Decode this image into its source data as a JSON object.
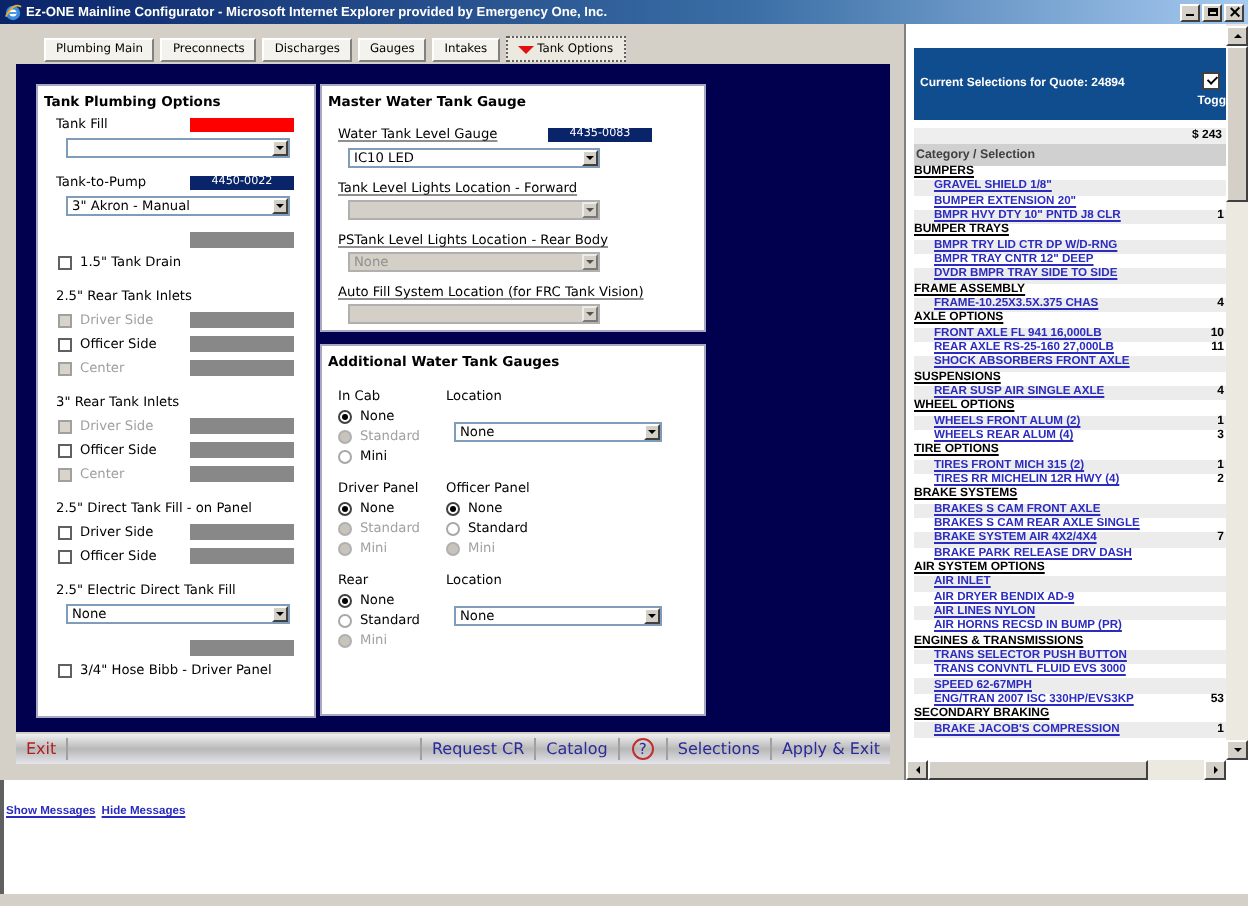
{
  "window": {
    "title": "Ez-ONE Mainline Configurator - Microsoft Internet Explorer provided by Emergency One, Inc."
  },
  "tabs": [
    {
      "label": "Plumbing Main",
      "selected": false
    },
    {
      "label": "Preconnects",
      "selected": false
    },
    {
      "label": "Discharges",
      "selected": false
    },
    {
      "label": "Gauges",
      "selected": false
    },
    {
      "label": "Intakes",
      "selected": false
    },
    {
      "label": "Tank Options",
      "selected": true
    }
  ],
  "tank_plumbing": {
    "title": "Tank Plumbing Options",
    "rows": [
      {
        "kind": "label_tag",
        "label": "Tank Fill",
        "color": "#ff0000"
      },
      {
        "kind": "select",
        "disabled": false
      },
      {
        "kind": "label_tag",
        "label": "Tank-to-Pump",
        "tag": "4450-0022",
        "color": "#0a246a"
      },
      {
        "kind": "select",
        "value": "3\" Akron - Manual",
        "disabled": false
      },
      {
        "kind": "bar"
      },
      {
        "kind": "checkbox",
        "label": "1.5\" Tank Drain",
        "checked": false,
        "disabled": false,
        "bar": false
      },
      {
        "kind": "heading",
        "label": "2.5\" Rear Tank Inlets"
      },
      {
        "kind": "checkbox",
        "label": "Driver Side",
        "checked": false,
        "disabled": true,
        "bar": true
      },
      {
        "kind": "checkbox",
        "label": "Officer Side",
        "checked": false,
        "disabled": false,
        "bar": true
      },
      {
        "kind": "checkbox",
        "label": "Center",
        "checked": false,
        "disabled": true,
        "bar": true
      },
      {
        "kind": "heading",
        "label": "3\" Rear Tank Inlets"
      },
      {
        "kind": "checkbox",
        "label": "Driver Side",
        "checked": false,
        "disabled": true,
        "bar": true
      },
      {
        "kind": "checkbox",
        "label": "Officer Side",
        "checked": false,
        "disabled": false,
        "bar": true
      },
      {
        "kind": "checkbox",
        "label": "Center",
        "checked": false,
        "disabled": true,
        "bar": true
      },
      {
        "kind": "heading",
        "label": "2.5\" Direct Tank Fill - on Panel"
      },
      {
        "kind": "checkbox",
        "label": "Driver Side",
        "checked": false,
        "disabled": false,
        "bar": true
      },
      {
        "kind": "checkbox",
        "label": "Officer Side",
        "checked": false,
        "disabled": false,
        "bar": true
      },
      {
        "kind": "heading",
        "label": "2.5\" Electric Direct Tank Fill"
      },
      {
        "kind": "select",
        "value": "None",
        "disabled": false
      },
      {
        "kind": "bar"
      },
      {
        "kind": "checkbox",
        "label": "3/4\" Hose Bibb - Driver Panel",
        "checked": false,
        "disabled": false,
        "bar": false
      }
    ]
  },
  "master_gauge": {
    "title": "Master Water Tank Gauge",
    "rows": [
      {
        "kind": "label_tag",
        "label": "Water Tank Level Gauge",
        "tag": "4435-0083",
        "color": "#0a246a"
      },
      {
        "kind": "select",
        "value": "IC10 LED",
        "disabled": false
      },
      {
        "kind": "label",
        "label": "Tank Level Lights Location - Forward"
      },
      {
        "kind": "select",
        "disabled": true
      },
      {
        "kind": "label",
        "label": "PSTank Level Lights Location - Rear Body"
      },
      {
        "kind": "select",
        "value": "None",
        "disabled": true
      },
      {
        "kind": "label",
        "label": "Auto Fill System Location (for FRC Tank Vision)"
      },
      {
        "kind": "select",
        "disabled": true
      }
    ]
  },
  "additional_gauges": {
    "title": "Additional Water Tank Gauges",
    "groups": [
      {
        "left": {
          "kind": "radios",
          "label": "In Cab",
          "options": [
            {
              "label": "None",
              "selected": true,
              "disabled": false
            },
            {
              "label": "Standard",
              "selected": false,
              "disabled": true
            },
            {
              "label": "Mini",
              "selected": false,
              "disabled": false
            }
          ]
        },
        "right": {
          "kind": "select",
          "label": "Location",
          "value": "None"
        }
      },
      {
        "left": {
          "kind": "radios",
          "label": "Driver Panel",
          "options": [
            {
              "label": "None",
              "selected": true,
              "disabled": false
            },
            {
              "label": "Standard",
              "selected": false,
              "disabled": true
            },
            {
              "label": "Mini",
              "selected": false,
              "disabled": true
            }
          ]
        },
        "right": {
          "kind": "radios",
          "label": "Officer Panel",
          "options": [
            {
              "label": "None",
              "selected": true,
              "disabled": false
            },
            {
              "label": "Standard",
              "selected": false,
              "disabled": false
            },
            {
              "label": "Mini",
              "selected": false,
              "disabled": true
            }
          ]
        }
      },
      {
        "left": {
          "kind": "radios",
          "label": "Rear",
          "options": [
            {
              "label": "None",
              "selected": true,
              "disabled": false
            },
            {
              "label": "Standard",
              "selected": false,
              "disabled": false
            },
            {
              "label": "Mini",
              "selected": false,
              "disabled": true
            }
          ]
        },
        "right": {
          "kind": "select",
          "label": "Location",
          "value": "None"
        }
      }
    ]
  },
  "toolbar": {
    "items": [
      {
        "kind": "exit",
        "label": "Exit"
      },
      {
        "kind": "link",
        "label": "Request CR"
      },
      {
        "kind": "link",
        "label": "Catalog"
      },
      {
        "kind": "help",
        "label": "?"
      },
      {
        "kind": "link",
        "label": "Selections"
      },
      {
        "kind": "link",
        "label": "Apply & Exit"
      }
    ]
  },
  "selections": {
    "title": "Current Selections for Quote: 24894",
    "toggle": {
      "label": "Togg",
      "checked": true
    },
    "total": "$ 243",
    "column": "Category / Selection",
    "categories": [
      {
        "name": "BUMPERS",
        "items": [
          {
            "name": "GRAVEL SHIELD 1/8\""
          },
          {
            "name": "BUMPER EXTENSION 20\""
          },
          {
            "name": "BMPR HVY DTY 10\" PNTD J8 CLR",
            "amount": "1"
          }
        ]
      },
      {
        "name": "BUMPER TRAYS",
        "items": [
          {
            "name": "BMPR TRY LID CTR DP W/D-RNG"
          },
          {
            "name": "BMPR TRAY CNTR 12\" DEEP"
          },
          {
            "name": "DVDR BMPR TRAY SIDE TO SIDE"
          }
        ]
      },
      {
        "name": "FRAME ASSEMBLY",
        "items": [
          {
            "name": "FRAME-10.25X3.5X.375 CHAS",
            "amount": "4"
          }
        ]
      },
      {
        "name": "AXLE OPTIONS",
        "items": [
          {
            "name": "FRONT AXLE FL 941 16,000LB",
            "amount": "10"
          },
          {
            "name": "REAR AXLE RS-25-160 27,000LB",
            "amount": "11"
          },
          {
            "name": "SHOCK ABSORBERS FRONT AXLE"
          }
        ]
      },
      {
        "name": "SUSPENSIONS",
        "items": [
          {
            "name": "REAR SUSP AIR SINGLE AXLE",
            "amount": "4"
          }
        ]
      },
      {
        "name": "WHEEL OPTIONS",
        "items": [
          {
            "name": "WHEELS FRONT ALUM (2)",
            "amount": "1"
          },
          {
            "name": "WHEELS REAR ALUM (4)",
            "amount": "3"
          }
        ]
      },
      {
        "name": "TIRE OPTIONS",
        "items": [
          {
            "name": "TIRES FRONT MICH 315 (2)",
            "amount": "1"
          },
          {
            "name": "TIRES RR MICHELIN 12R HWY (4)",
            "amount": "2"
          }
        ]
      },
      {
        "name": "BRAKE SYSTEMS",
        "items": [
          {
            "name": "BRAKES S CAM FRONT AXLE"
          },
          {
            "name": "BRAKES S CAM REAR AXLE SINGLE"
          },
          {
            "name": "BRAKE SYSTEM AIR 4X2/4X4",
            "amount": "7"
          },
          {
            "name": "BRAKE PARK RELEASE DRV DASH"
          }
        ]
      },
      {
        "name": "AIR SYSTEM OPTIONS",
        "items": [
          {
            "name": "AIR INLET"
          },
          {
            "name": "AIR DRYER BENDIX AD-9"
          },
          {
            "name": "AIR LINES NYLON"
          },
          {
            "name": "AIR HORNS RECSD IN BUMP (PR)"
          }
        ]
      },
      {
        "name": "ENGINES & TRANSMISSIONS",
        "items": [
          {
            "name": "TRANS SELECTOR PUSH BUTTON"
          },
          {
            "name": "TRANS CONVNTL FLUID EVS 3000"
          },
          {
            "name": "SPEED 62-67MPH"
          },
          {
            "name": "ENG/TRAN 2007 ISC 330HP/EVS3KP",
            "amount": "53"
          }
        ]
      },
      {
        "name": "SECONDARY BRAKING",
        "items": [
          {
            "name": "BRAKE JACOB'S COMPRESSION",
            "amount": "1"
          }
        ]
      }
    ]
  },
  "messages": [
    {
      "label": "Show Messages"
    },
    {
      "label": "Hide Messages"
    }
  ]
}
